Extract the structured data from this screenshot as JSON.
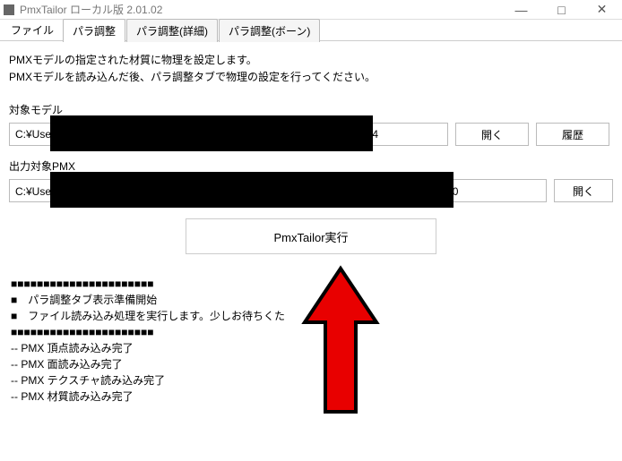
{
  "window": {
    "title": "PmxTailor ローカル版 2.01.02",
    "controls": {
      "minimize": "—",
      "maximize": "□",
      "close": "✕"
    }
  },
  "menu": {
    "file": "ファイル"
  },
  "tabs": {
    "para": "パラ調整",
    "para_detail": "パラ調整(詳細)",
    "para_bone": "パラ調整(ボーン)"
  },
  "description": {
    "line1": "PMXモデルの指定された材質に物理を設定します。",
    "line2": "PMXモデルを読み込んだ後、パラ調整タブで物理の設定を行ってください。"
  },
  "fields": {
    "target_model": {
      "label": "対象モデル",
      "value": "C:¥Use                                                                                          0241110_14",
      "open": "開く",
      "history": "履歴"
    },
    "output_pmx": {
      "label": "出力対象PMX",
      "value": "C:¥Use                                                                                                              19¥サンプル_20",
      "open": "開く"
    }
  },
  "execute": {
    "label": "PmxTailor実行"
  },
  "log": {
    "l1": "■■■■■■■■■■■■■■■■■■■■■■",
    "l2": "■　パラ調整タブ表示準備開始",
    "l3": "■　ファイル読み込み処理を実行します。少しお待ちくた",
    "l4": "■■■■■■■■■■■■■■■■■■■■■■",
    "l5": "-- PMX 頂点読み込み完了",
    "l6": "-- PMX 面読み込み完了",
    "l7": "-- PMX テクスチャ読み込み完了",
    "l8": "-- PMX 材質読み込み完了"
  }
}
